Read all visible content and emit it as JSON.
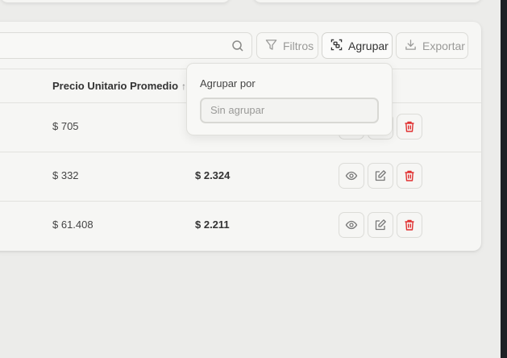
{
  "toolbar": {
    "search_placeholder": "",
    "filter_label": "Filtros",
    "group_label": "Agrupar",
    "export_label": "Exportar"
  },
  "table": {
    "columns": [
      {
        "label": "Precio Unitario Promedio",
        "sort_icon": "↑↓"
      },
      {
        "label": ""
      }
    ],
    "rows": [
      {
        "unit_price": "$ 705",
        "total": ""
      },
      {
        "unit_price": "$ 332",
        "total": "$ 2.324"
      },
      {
        "unit_price": "$ 61.408",
        "total": "$ 2.211"
      }
    ]
  },
  "group_popover": {
    "title": "Agrupar por",
    "selected": "Sin agrupar"
  },
  "icons": {
    "search": "search-icon",
    "filter": "filter-icon",
    "group": "group-icon",
    "export": "download-icon",
    "view": "eye-icon",
    "edit": "edit-icon",
    "delete": "trash-icon"
  },
  "colors": {
    "background": "#ececea",
    "panel": "#f6f6f4",
    "delete_accent": "#e03131"
  }
}
